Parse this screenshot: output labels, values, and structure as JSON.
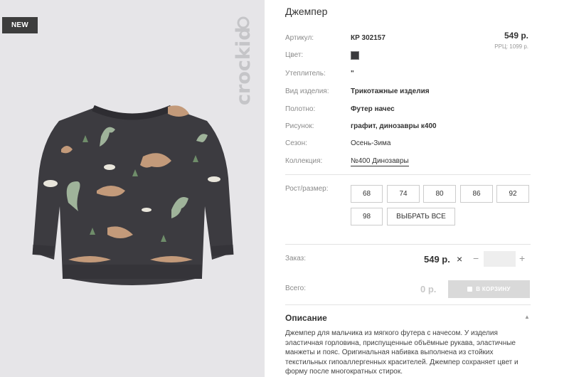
{
  "badge": "NEW",
  "brand_logo_text": "crockid",
  "product": {
    "title": "Джемпер",
    "price": "549 р.",
    "rrc": "РРЦ: 1099 р.",
    "attributes": [
      {
        "label": "Артикул:",
        "value": "КР 302157"
      },
      {
        "label": "Цвет:",
        "value": "",
        "swatch": "#3a3a3c"
      },
      {
        "label": "Утеплитель:",
        "value": "\""
      },
      {
        "label": "Вид изделия:",
        "value": "Трикотажные изделия"
      },
      {
        "label": "Полотно:",
        "value": "Футер начес"
      },
      {
        "label": "Рисунок:",
        "value": "графит, динозавры к400"
      },
      {
        "label": "Сезон:",
        "value": "Осень-Зима"
      },
      {
        "label": "Коллекция:",
        "value": "№400 Динозавры"
      }
    ]
  },
  "sizes": {
    "label": "Рост/размер:",
    "options": [
      "68",
      "74",
      "80",
      "86",
      "92",
      "98"
    ],
    "select_all": "ВЫБРАТЬ ВСЕ"
  },
  "order": {
    "label": "Заказ:",
    "sum": "549 р.",
    "remove_icon": "×",
    "minus": "−",
    "plus": "+",
    "quantity": ""
  },
  "total": {
    "label": "Всего:",
    "sum": "0 р.",
    "cart_button": "В КОРЗИНУ"
  },
  "description": {
    "title": "Описание",
    "caret": "▲",
    "text": "Джемпер для мальчика из мягкого футера с начесом. У изделия эластичная горловина, приспущенные объёмные рукава, эластичные манжеты и пояс. Оригинальная набивка выполнена из стойких текстильных гипоаллергенных красителей. Джемпер сохраняет цвет и форму после многократных стирок."
  },
  "colors": {
    "photo_bg": "#e6e5e8",
    "sweater": "#3c3b40",
    "cart_disabled": "#d9d9d9"
  }
}
